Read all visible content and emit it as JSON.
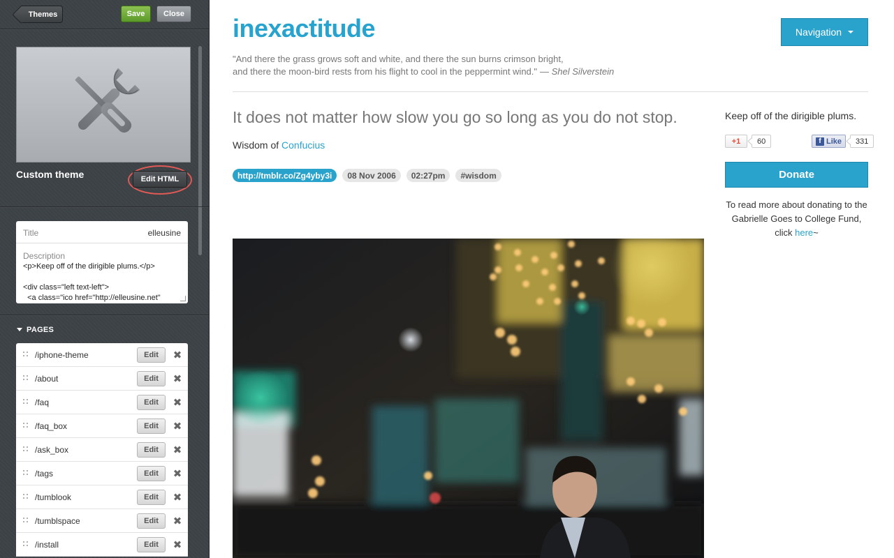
{
  "sidebar": {
    "themes_label": "Themes",
    "save_label": "Save",
    "close_label": "Close",
    "theme_name": "Custom theme",
    "edit_html_label": "Edit HTML",
    "info": {
      "title_label": "Title",
      "title_value": "elleusine",
      "description_label": "Description",
      "description_value": "<p>Keep off of the dirigible plums.</p>\n\n<div class=\"left text-left\">\n  <a class=\"ico href=\"http://elleusine.net\""
    },
    "pages_header": "PAGES",
    "edit_label": "Edit",
    "pages": [
      {
        "path": "/iphone-theme"
      },
      {
        "path": "/about"
      },
      {
        "path": "/faq"
      },
      {
        "path": "/faq_box"
      },
      {
        "path": "/ask_box"
      },
      {
        "path": "/tags"
      },
      {
        "path": "/tumblook"
      },
      {
        "path": "/tumblspace"
      },
      {
        "path": "/install"
      }
    ]
  },
  "blog": {
    "title": "inexactitude",
    "quote_line1": "\"And there the grass grows soft and white, and there the sun burns crimson bright,",
    "quote_line2": "and there the moon-bird rests from his flight to cool in the peppermint wind.\"",
    "quote_author": "— Shel Silverstein",
    "nav_label": "Navigation"
  },
  "post": {
    "heading": "It does not matter how slow you go so long as you do not stop.",
    "source_prefix": "Wisdom of ",
    "source_link": "Confucius",
    "tags": [
      {
        "text": "http://tmblr.co/Zg4yby3i",
        "kind": "link"
      },
      {
        "text": "08 Nov 2006",
        "kind": "plain"
      },
      {
        "text": "02:27pm",
        "kind": "plain"
      },
      {
        "text": "#wisdom",
        "kind": "plain"
      }
    ]
  },
  "side": {
    "description": "Keep off of the dirigible plums.",
    "gplus_label": "+1",
    "gplus_count": "60",
    "fb_label": "Like",
    "fb_count": "331",
    "donate_label": "Donate",
    "donate_text_1": "To read more about donating to the Gabrielle Goes to College Fund, click ",
    "donate_link": "here",
    "donate_text_2": "~"
  },
  "colors": {
    "accent": "#2aa3cc",
    "save_green": "#6aab36",
    "sidebar_bg": "#3d4247",
    "highlight_ring": "#e05a55"
  }
}
